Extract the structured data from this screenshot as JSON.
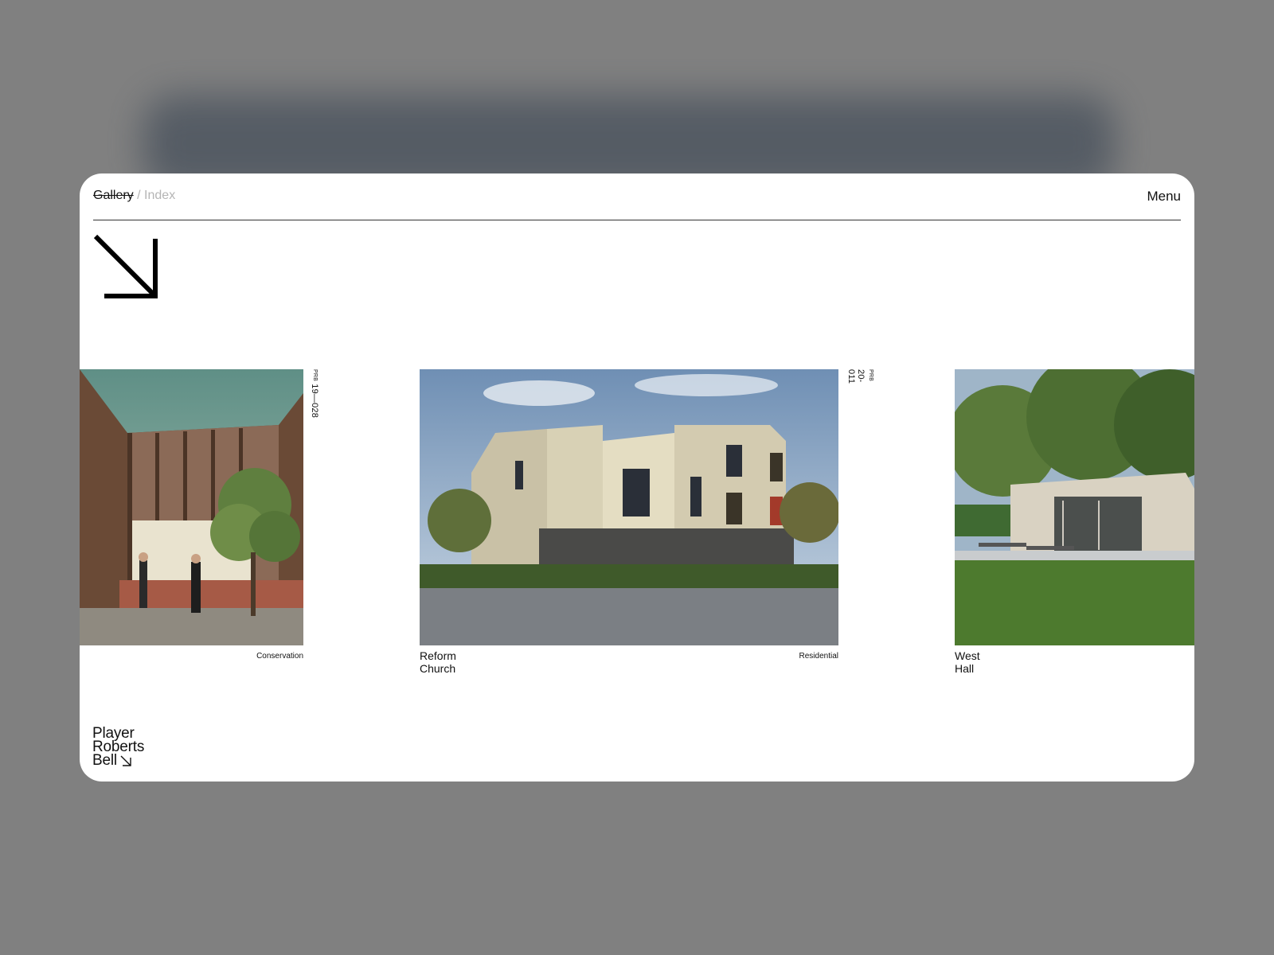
{
  "nav": {
    "gallery": "Gallery",
    "separator": "/",
    "index": "Index",
    "menu": "Menu"
  },
  "projects": [
    {
      "code_prefix": "PRB",
      "code": "19—028",
      "name": "",
      "category": "Conservation"
    },
    {
      "code_prefix": "PRB",
      "code": "20-011",
      "name": "Reform Church",
      "category": "Residential"
    },
    {
      "code_prefix": "",
      "code": "",
      "name": "West Hall",
      "category": ""
    }
  ],
  "logo": {
    "line1": "Player",
    "line2": "Roberts",
    "line3": "Bell"
  },
  "icons": {
    "hero": "arrow-down-right-icon",
    "logo": "arrow-down-right-icon"
  },
  "colors": {
    "overlay": "#808080",
    "surface": "#ffffff",
    "text": "#111111",
    "muted": "#b5b5b5"
  }
}
